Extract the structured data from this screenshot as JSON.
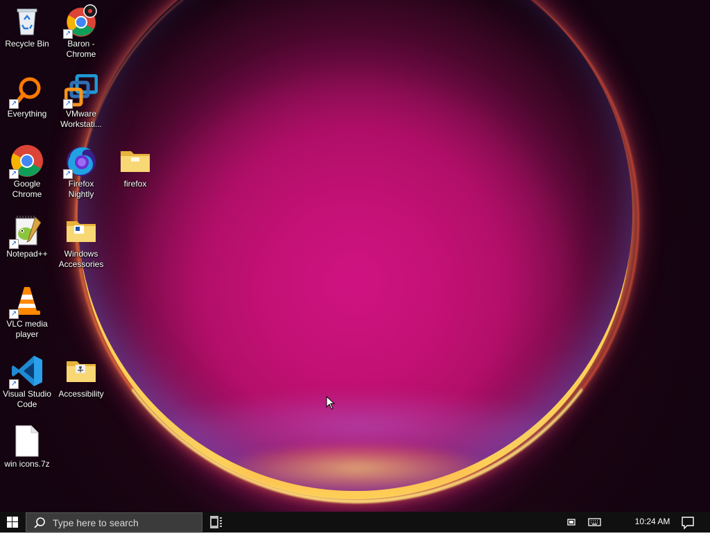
{
  "desktop_icons": [
    {
      "label": "Recycle Bin",
      "icon": "recycle-bin-icon",
      "shortcut": false
    },
    {
      "label": "Baron - Chrome",
      "icon": "baron-chrome-icon",
      "shortcut": true
    },
    {
      "label": "Everything",
      "icon": "everything-search-icon",
      "shortcut": true
    },
    {
      "label": "VMware Workstati...",
      "icon": "vmware-workstation-icon",
      "shortcut": true
    },
    {
      "label": "Google Chrome",
      "icon": "google-chrome-icon",
      "shortcut": true
    },
    {
      "label": "Firefox Nightly",
      "icon": "firefox-nightly-icon",
      "shortcut": true
    },
    {
      "label": "firefox",
      "icon": "folder-icon",
      "shortcut": false
    },
    {
      "label": "Notepad++",
      "icon": "notepad-plus-plus-icon",
      "shortcut": true
    },
    {
      "label": "Windows Accessories",
      "icon": "folder-icon",
      "shortcut": false
    },
    {
      "label": "VLC media player",
      "icon": "vlc-cone-icon",
      "shortcut": true
    },
    {
      "label": "Visual Studio Code",
      "icon": "vscode-icon",
      "shortcut": true
    },
    {
      "label": "Accessibility",
      "icon": "folder-icon",
      "shortcut": false
    },
    {
      "label": "win icons.7z",
      "icon": "file-icon",
      "shortcut": false
    }
  ],
  "taskbar": {
    "search_placeholder": "Type here to search",
    "start_icon": "windows-logo-icon",
    "search_icon": "search-icon",
    "task_view_icon": "task-view-icon",
    "tray_icons": [
      "tray-app-icon",
      "keyboard-icon",
      "notification-icon"
    ],
    "clock": "10:24 AM"
  },
  "colors": {
    "taskbar_bg": "#101010",
    "search_bg": "#3b3b3b",
    "wallpaper_center": "#c0107a",
    "ring_glow": "#ffd75a"
  }
}
